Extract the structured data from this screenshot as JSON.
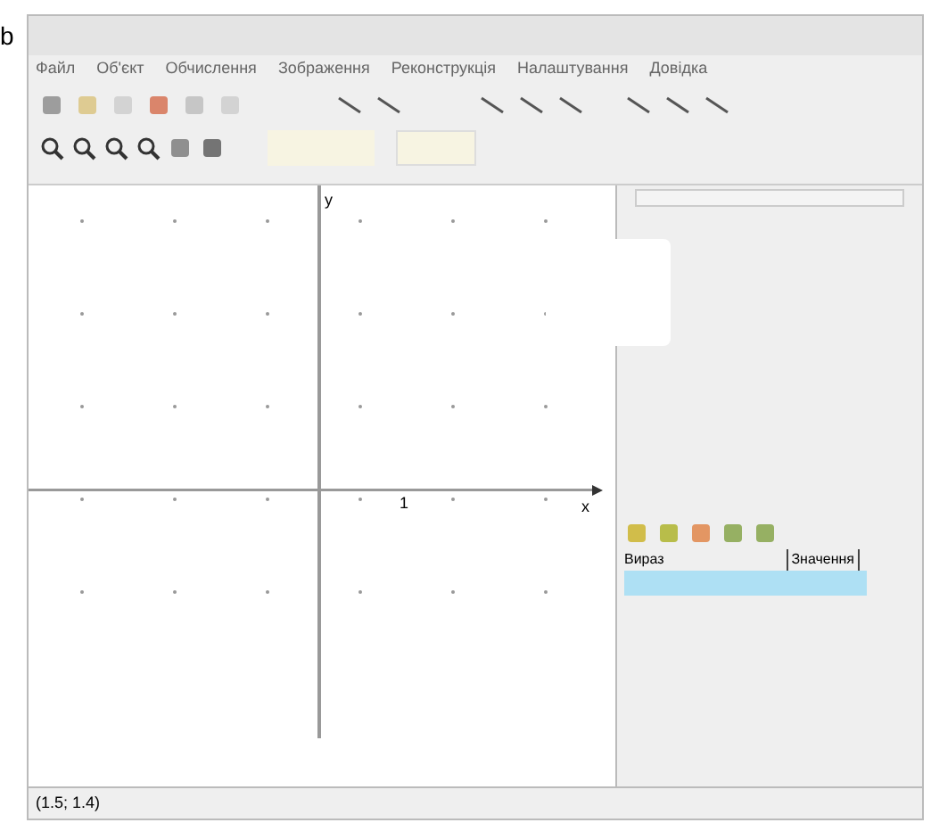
{
  "figure_label": "b",
  "menu": [
    "Файл",
    "Об'єкт",
    "Обчислення",
    "Зображення",
    "Реконструкція",
    "Налаштування",
    "Довідка"
  ],
  "plot": {
    "y_axis_label": "y",
    "x_axis_label": "x",
    "tick_label": "1"
  },
  "panel": {
    "columns": [
      "Вираз",
      "Значення"
    ],
    "rows": [
      {
        "selected": true
      }
    ]
  },
  "status_bar": "(1.5; 1.4)"
}
